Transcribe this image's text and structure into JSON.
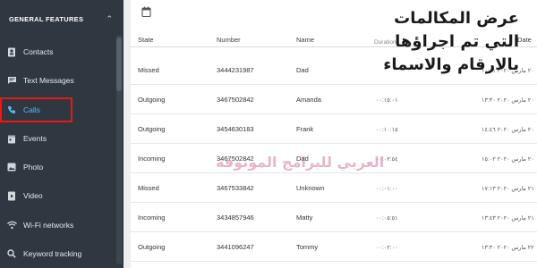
{
  "sidebar": {
    "section_title": "GENERAL FEATURES",
    "items": [
      {
        "label": "Contacts"
      },
      {
        "label": "Text Messages"
      },
      {
        "label": "Calls"
      },
      {
        "label": "Events"
      },
      {
        "label": "Photo"
      },
      {
        "label": "Video"
      },
      {
        "label": "Wi-Fi networks"
      },
      {
        "label": "Keyword tracking"
      }
    ]
  },
  "overlay": {
    "line1": "عرض المكالمات",
    "line2": "التي تم اجراؤها",
    "line3": "بالارقام والاسماء",
    "watermark": "العربي للبرامج الموثوقة"
  },
  "table": {
    "columns": {
      "state": "State",
      "number": "Number",
      "name": "Name",
      "duration": "Duration",
      "date": "Date"
    },
    "rows": [
      {
        "state": "Missed",
        "number": "3444231987",
        "name": "Dad",
        "duration": "",
        "date": "٢٠ مارس ٢٠٢٠ ١٠:٠١"
      },
      {
        "state": "Outgoing",
        "number": "3467502842",
        "name": "Amanda",
        "duration": "٠٠:١٥:٠١",
        "date": "٢٠ مارس ٢٠٢٠ ١٣:٣٠"
      },
      {
        "state": "Outgoing",
        "number": "3454630183",
        "name": "Frank",
        "duration": "٠٠:١٠:١٥",
        "date": "٢٠ مارس ٢٠٢٠ ١٤:٤٦"
      },
      {
        "state": "Incoming",
        "number": "3467502842",
        "name": "Dad",
        "duration": "٠٠:٠٢:٥٤",
        "date": "٢٠ مارس ٢٠٢٠ ١٥:٠٢"
      },
      {
        "state": "Missed",
        "number": "3467533842",
        "name": "Unknown",
        "duration": "٠٠:٠١:٠٠",
        "date": "٢١ مارس ٢٠٢٠ ١٧:١٣"
      },
      {
        "state": "Incoming",
        "number": "3434857946",
        "name": "Matty",
        "duration": "٠٠:٠٥:٥١",
        "date": "٢١ مارس ٢٠٢٠ ١٣:٤٣"
      },
      {
        "state": "Outgoing",
        "number": "3441096247",
        "name": "Tommy",
        "duration": "٠٠:٠٢:٠٠",
        "date": "٢٢ مارس ٢٠٢٠ ١٣:٣٠"
      }
    ]
  },
  "colors": {
    "sidebar_bg": "#2f3840",
    "active_text": "#64b5f6",
    "highlight_border": "#e01b1b"
  },
  "icons": {
    "toolbar": "calendar-icon"
  }
}
